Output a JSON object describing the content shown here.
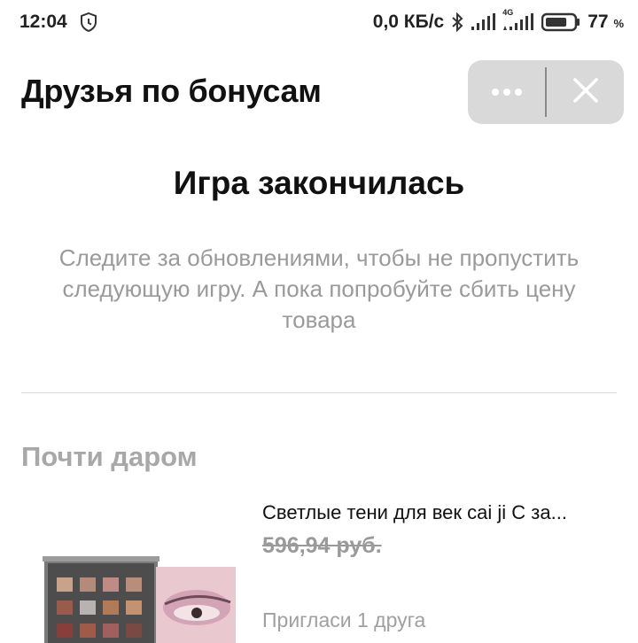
{
  "status_bar": {
    "time": "12:04",
    "speed": "0,0 КБ/с",
    "network": "4G",
    "battery": "77",
    "battery_unit": "%",
    "battery_level": 0.77,
    "icons": [
      "alarm-shield-icon",
      "bluetooth-icon",
      "signal-icon",
      "signal-4g-icon",
      "battery-icon"
    ]
  },
  "header": {
    "title": "Друзья по бонусам",
    "menu_icon": "more-dots-icon",
    "close_icon": "close-icon"
  },
  "game": {
    "title": "Игра закончилась",
    "description": "Следите за обновлениями, чтобы не пропустить следующую игру. А пока попробуйте сбить цену товара"
  },
  "section": {
    "title": "Почти даром"
  },
  "product": {
    "name": "Светлые тени для век cai ji C за...",
    "old_price": "596,94 руб.",
    "invite_text": "Пригласи 1 друга"
  },
  "colors": {
    "capsule_bg": "#d9d9d9",
    "muted_text": "#9a9a9a",
    "divider": "#dcdcdc"
  }
}
